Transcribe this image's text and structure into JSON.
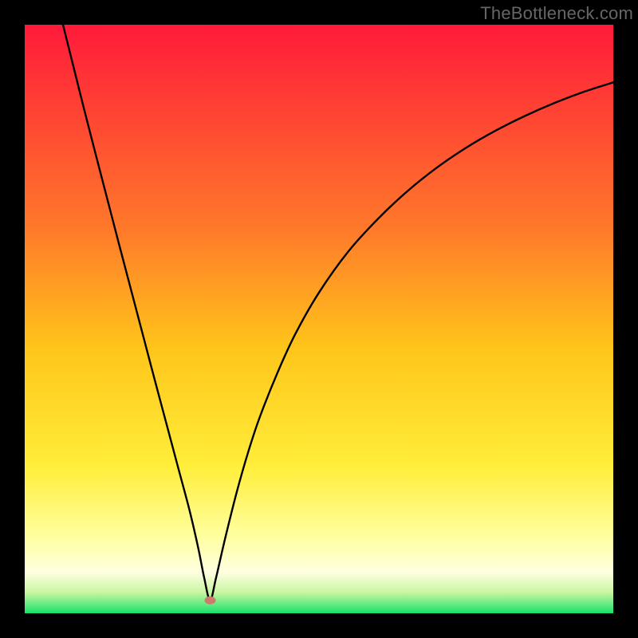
{
  "watermark": "TheBottleneck.com",
  "chart_data": {
    "type": "line",
    "title": "",
    "xlabel": "",
    "ylabel": "",
    "xlim": [
      0,
      100
    ],
    "ylim": [
      0,
      100
    ],
    "grid": false,
    "legend": false,
    "colors": {
      "curve": "#000000",
      "marker": "#cf7b6b",
      "gradient_top": "#ff1a3a",
      "gradient_mid1": "#ff8a2a",
      "gradient_mid2": "#ffd21a",
      "gradient_mid3": "#ffff6a",
      "gradient_bottom": "#16e36b"
    },
    "gradient_stops": [
      {
        "offset": 0.0,
        "color": "#ff1a3a"
      },
      {
        "offset": 0.35,
        "color": "#ff7a2a"
      },
      {
        "offset": 0.55,
        "color": "#ffc51a"
      },
      {
        "offset": 0.75,
        "color": "#ffee3a"
      },
      {
        "offset": 0.87,
        "color": "#ffffa0"
      },
      {
        "offset": 0.93,
        "color": "#ffffe0"
      },
      {
        "offset": 0.965,
        "color": "#c8f5a0"
      },
      {
        "offset": 1.0,
        "color": "#16e36b"
      }
    ],
    "minimum_point": {
      "x": 31.5,
      "y": 2.2
    },
    "series": [
      {
        "name": "bottleneck-curve",
        "x": [
          6.5,
          8,
          10,
          12,
          14,
          16,
          18,
          20,
          22,
          24,
          26,
          28,
          29.5,
          30.5,
          31.5,
          32.5,
          34,
          36,
          38,
          40,
          43,
          46,
          50,
          55,
          60,
          65,
          70,
          75,
          80,
          85,
          90,
          95,
          100
        ],
        "y": [
          100,
          94.0,
          86.0,
          78.2,
          70.5,
          62.8,
          55.2,
          47.6,
          40.0,
          32.5,
          25.0,
          17.5,
          11.0,
          6.0,
          2.2,
          6.0,
          12.5,
          20.5,
          27.5,
          33.5,
          41.0,
          47.5,
          54.5,
          61.5,
          67.0,
          71.7,
          75.7,
          79.1,
          82.0,
          84.5,
          86.7,
          88.6,
          90.2
        ]
      }
    ]
  }
}
